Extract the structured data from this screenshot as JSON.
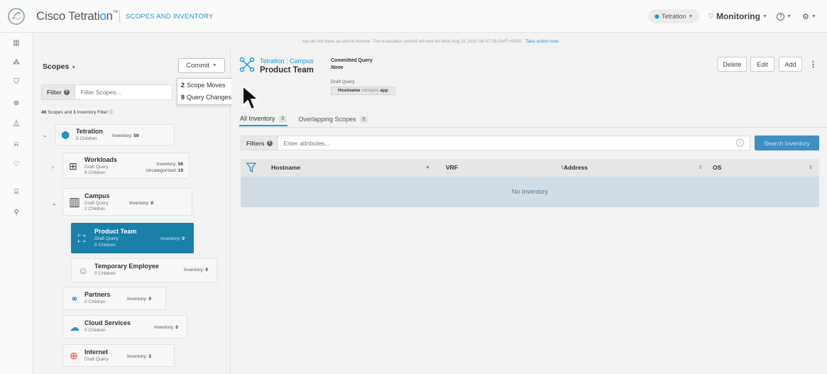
{
  "app": {
    "brand": "Cisco Tetrati",
    "brand_o": "o",
    "brand_n": "n",
    "brand_tm": "™",
    "section": "SCOPES AND INVENTORY",
    "scope_selector": "Tetration",
    "monitoring": "Monitoring",
    "help": "?",
    "settings": "⚙"
  },
  "banner": {
    "text": "You do not have an active license. The evaluation period will end on Mon Aug 31 2020 08:47:08 GMT+0000.",
    "link": "Take action now."
  },
  "scopes": {
    "title": "Scopes",
    "commit_label": "Commit",
    "filter_label": "Filter",
    "filter_placeholder": "Filter Scopes...",
    "count_prefix": "46",
    "count_mid": " Scopes and ",
    "count_num": "1",
    "count_suffix": " Inventory Filter",
    "tree": [
      {
        "name": "Tetration",
        "sub1": "5 Children",
        "sub2": "",
        "inv_label": "Inventory:",
        "inv": "59",
        "extra_label": "",
        "extra": "",
        "icon": "cube-icon"
      },
      {
        "name": "Workloads",
        "sub1": "Draft Query",
        "sub2": "9 Children",
        "inv_label": "Inventory:",
        "inv": "56",
        "extra_label": "Uncategorized:",
        "extra": "19",
        "icon": "workloads-icon"
      },
      {
        "name": "Campus",
        "sub1": "Draft Query",
        "sub2": "2 Children",
        "inv_label": "Inventory:",
        "inv": "0",
        "extra_label": "",
        "extra": "",
        "icon": "building-icon"
      },
      {
        "name": "Product Team",
        "sub1": "Draft Query",
        "sub2": "0 Children",
        "inv_label": "Inventory:",
        "inv": "0",
        "extra_label": "",
        "extra": "",
        "icon": "network-icon"
      },
      {
        "name": "Temporary Employee",
        "sub1": "0 Children",
        "sub2": "",
        "inv_label": "Inventory:",
        "inv": "0",
        "extra_label": "",
        "extra": "",
        "icon": "user-icon"
      },
      {
        "name": "Partners",
        "sub1": "0 Children",
        "sub2": "",
        "inv_label": "Inventory:",
        "inv": "0",
        "extra_label": "",
        "extra": "",
        "icon": "handshake-icon"
      },
      {
        "name": "Cloud Services",
        "sub1": "0 Children",
        "sub2": "",
        "inv_label": "Inventory:",
        "inv": "0",
        "extra_label": "",
        "extra": "",
        "icon": "cloud-icon"
      },
      {
        "name": "Internet",
        "sub1": "Draft Query",
        "sub2": "",
        "inv_label": "Inventory:",
        "inv": "3",
        "extra_label": "",
        "extra": "",
        "icon": "globe-icon"
      }
    ]
  },
  "commit_menu": [
    {
      "count": "2",
      "label": "Scope Moves"
    },
    {
      "count": "8",
      "label": "Query Changes"
    }
  ],
  "detail": {
    "crumb": "Tetration : Campus",
    "title": "Product Team",
    "committed_label": "Committed Query",
    "committed_value": "None",
    "draft_label": "Draft Query",
    "draft_field": "Hostname",
    "draft_op": "contains",
    "draft_value": "app",
    "actions": [
      "Delete",
      "Edit",
      "Add"
    ],
    "kebab": "⋮",
    "tabs": [
      {
        "label": "All Inventory",
        "count": "0"
      },
      {
        "label": "Overlapping Scopes",
        "count": "0"
      }
    ],
    "filters_label": "Filters",
    "filters_placeholder": "Enter attributes...",
    "search_label": "Search Inventory",
    "columns": [
      "Hostname",
      "VRF",
      "Address",
      "OS"
    ],
    "empty_text": "No Inventory"
  },
  "colors": {
    "accent": "#1b9bd7",
    "selected": "#1a7fa9",
    "search_button": "#3f8fc6"
  }
}
